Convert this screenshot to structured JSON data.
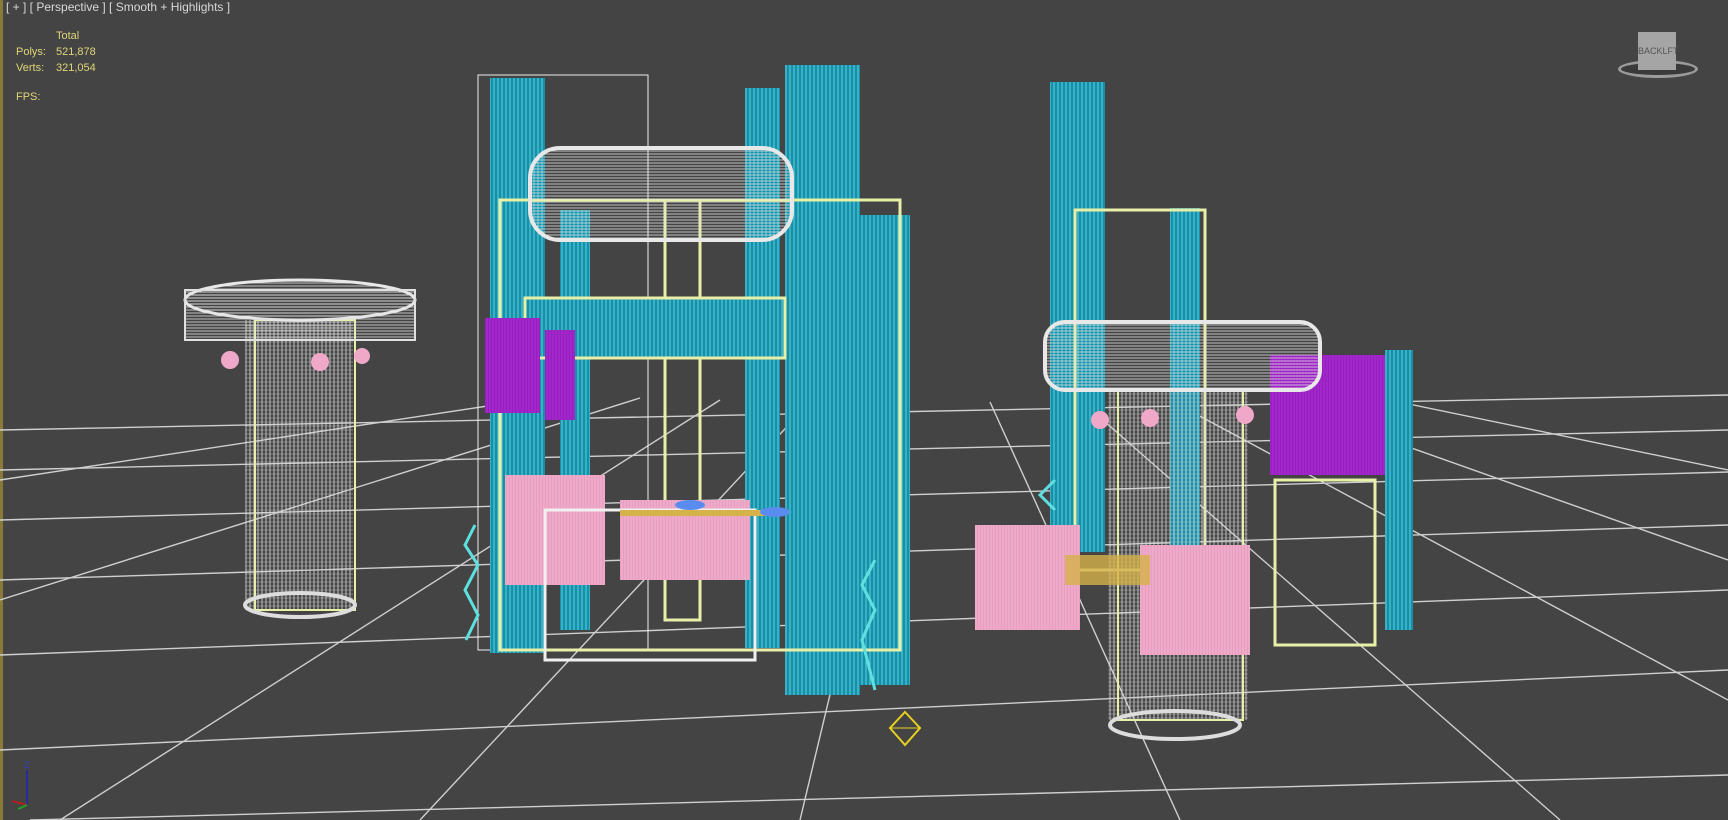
{
  "viewport": {
    "label": "[ + ] [ Perspective ] [ Smooth + Highlights ]",
    "stats": {
      "header": "Total",
      "polys_label": "Polys:",
      "polys_value": "521,878",
      "verts_label": "Verts:",
      "verts_value": "321,054",
      "fps_label": "FPS:"
    },
    "viewcube": {
      "face_back": "BACK",
      "face_left": "LFT"
    },
    "axis_gizmo": {
      "z_label": "Z"
    }
  },
  "colors": {
    "background": "#444444",
    "grid": "#d0d0d0",
    "teal": "#1a9fb8",
    "cream": "#e8f0a8",
    "white": "#e8e8e8",
    "pink": "#f0a8c8",
    "purple": "#a020c8",
    "stats_text": "#e0d67a"
  }
}
